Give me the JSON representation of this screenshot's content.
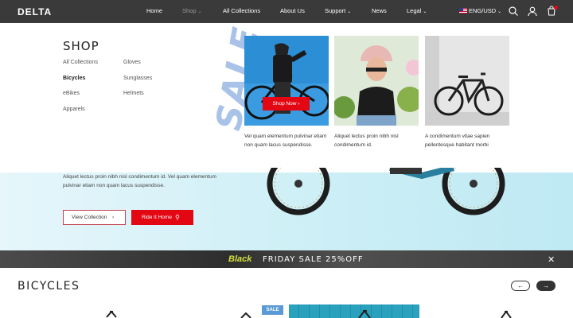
{
  "nav": {
    "logo": "DELTA",
    "items": [
      {
        "label": "Home"
      },
      {
        "label": "Shop"
      },
      {
        "label": "All Collections"
      },
      {
        "label": "About Us"
      },
      {
        "label": "Support"
      },
      {
        "label": "News"
      },
      {
        "label": "Legal"
      }
    ],
    "locale": "ENG/USD",
    "icons": [
      "search-icon",
      "user-icon",
      "cart-icon"
    ]
  },
  "mega": {
    "title": "SHOP",
    "col1": [
      "All Collections",
      "Bicycles",
      "eBikes",
      "Apparels"
    ],
    "col2": [
      "Gloves",
      "Sunglasses",
      "Helmets"
    ],
    "sale_word": "SALE",
    "shop_now": "Shop Now",
    "cards": [
      {
        "caption": "Vel quam elementum pulvinar etiam non quam lacus suspendisse."
      },
      {
        "caption": "Aliquet lectus proin nibh nisl condimentum id."
      },
      {
        "caption": "A condimentum vitae sapien pellentesque habitant morbi"
      }
    ]
  },
  "hero": {
    "text": "Aliquet lectus proin nibh nisl condimentum id. Vel quam elementum pulvinar etiam non quam lacus suspendisse.",
    "view_collection": "View Collection",
    "ride_it_home": "Ride It Home"
  },
  "promo": {
    "black": "Black",
    "rest": "FRIDAY SALE  25%OFF"
  },
  "bicycles": {
    "title": "BICYCLES",
    "sale_badge": "SALE"
  },
  "colors": {
    "accent": "#e30613",
    "nav_bg": "#3a3a3a",
    "sale_blue": "#a9c3e8"
  }
}
